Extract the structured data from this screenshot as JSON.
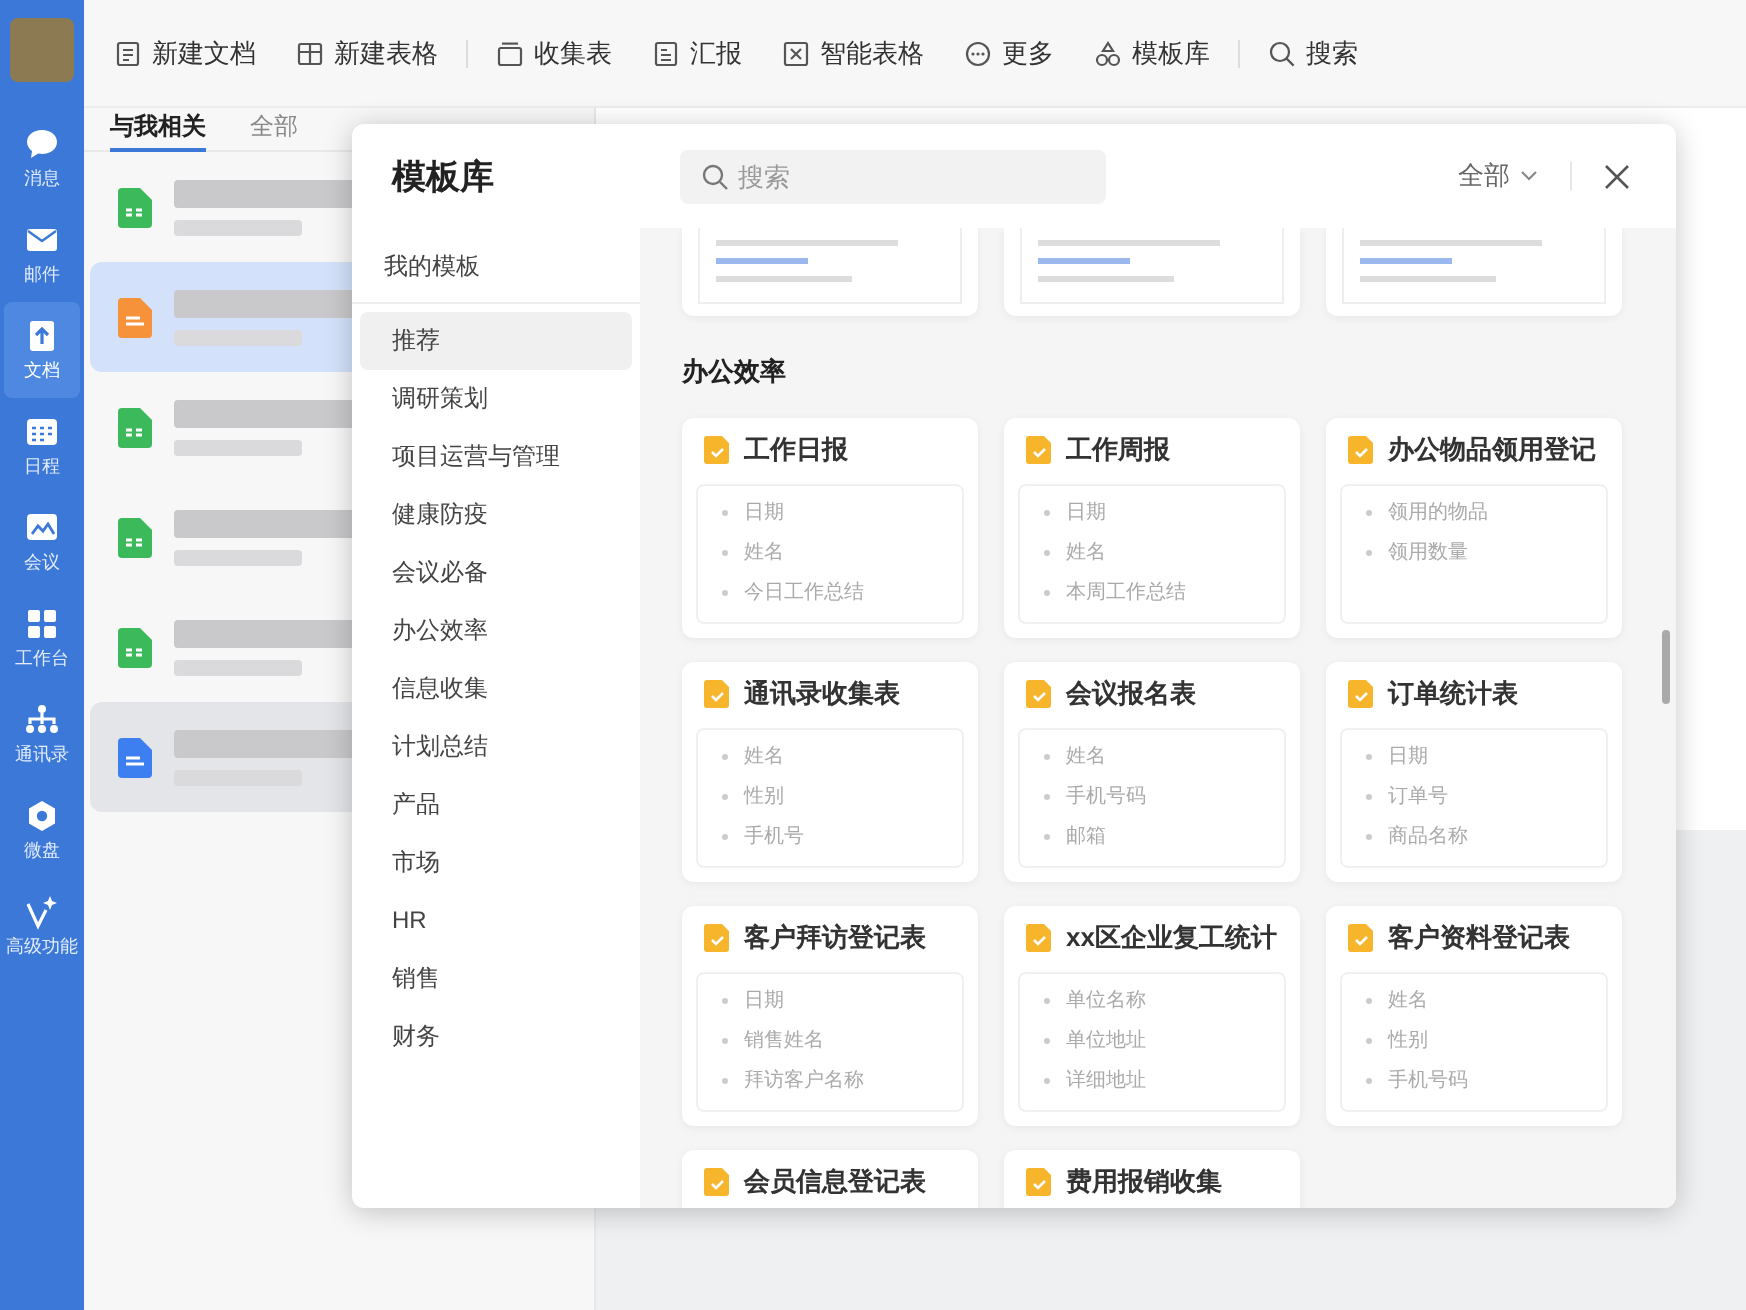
{
  "nav": {
    "items": [
      {
        "label": "消息",
        "selected": false
      },
      {
        "label": "邮件",
        "selected": false
      },
      {
        "label": "文档",
        "selected": true
      },
      {
        "label": "日程",
        "selected": false
      },
      {
        "label": "会议",
        "selected": false
      },
      {
        "label": "工作台",
        "selected": false
      },
      {
        "label": "通讯录",
        "selected": false
      },
      {
        "label": "微盘",
        "selected": false
      },
      {
        "label": "高级功能",
        "selected": false
      }
    ]
  },
  "toolbar": {
    "groups": [
      [
        "新建文档",
        "新建表格"
      ],
      [
        "收集表",
        "汇报",
        "智能表格",
        "更多",
        "模板库"
      ],
      [
        "搜索"
      ]
    ]
  },
  "file_list": {
    "tabs": [
      {
        "label": "与我相关",
        "selected": true
      },
      {
        "label": "全部",
        "selected": false
      }
    ],
    "rows": [
      {
        "kind": "sheet",
        "selected": false,
        "highlighted": false
      },
      {
        "kind": "form",
        "selected": true,
        "highlighted": false
      },
      {
        "kind": "sheet",
        "selected": false,
        "highlighted": false
      },
      {
        "kind": "sheet",
        "selected": false,
        "highlighted": false
      },
      {
        "kind": "sheet",
        "selected": false,
        "highlighted": false
      },
      {
        "kind": "doc",
        "selected": false,
        "highlighted": true
      }
    ]
  },
  "template_dialog": {
    "title": "模板库",
    "search": {
      "placeholder": "搜索"
    },
    "filter": "全部",
    "my_templates": "我的模板",
    "categories": [
      {
        "label": "推荐",
        "selected": true
      },
      {
        "label": "调研策划",
        "selected": false
      },
      {
        "label": "项目运营与管理",
        "selected": false
      },
      {
        "label": "健康防疫",
        "selected": false
      },
      {
        "label": "会议必备",
        "selected": false
      },
      {
        "label": "办公效率",
        "selected": false
      },
      {
        "label": "信息收集",
        "selected": false
      },
      {
        "label": "计划总结",
        "selected": false
      },
      {
        "label": "产品",
        "selected": false
      },
      {
        "label": "市场",
        "selected": false
      },
      {
        "label": "HR",
        "selected": false
      },
      {
        "label": "销售",
        "selected": false
      },
      {
        "label": "财务",
        "selected": false
      }
    ],
    "section_title": "办公效率",
    "templates": [
      {
        "title": "工作日报",
        "fields": [
          "日期",
          "姓名",
          "今日工作总结"
        ]
      },
      {
        "title": "工作周报",
        "fields": [
          "日期",
          "姓名",
          "本周工作总结"
        ]
      },
      {
        "title": "办公物品领用登记",
        "fields": [
          "领用的物品",
          "领用数量"
        ]
      },
      {
        "title": "通讯录收集表",
        "fields": [
          "姓名",
          "性别",
          "手机号"
        ]
      },
      {
        "title": "会议报名表",
        "fields": [
          "姓名",
          "手机号码",
          "邮箱"
        ]
      },
      {
        "title": "订单统计表",
        "fields": [
          "日期",
          "订单号",
          "商品名称"
        ]
      },
      {
        "title": "客户拜访登记表",
        "fields": [
          "日期",
          "销售姓名",
          "拜访客户名称"
        ]
      },
      {
        "title": "xx区企业复工统计",
        "fields": [
          "单位名称",
          "单位地址",
          "详细地址"
        ]
      },
      {
        "title": "客户资料登记表",
        "fields": [
          "姓名",
          "性别",
          "手机号码"
        ]
      },
      {
        "title": "会员信息登记表"
      },
      {
        "title": "费用报销收集"
      }
    ]
  }
}
